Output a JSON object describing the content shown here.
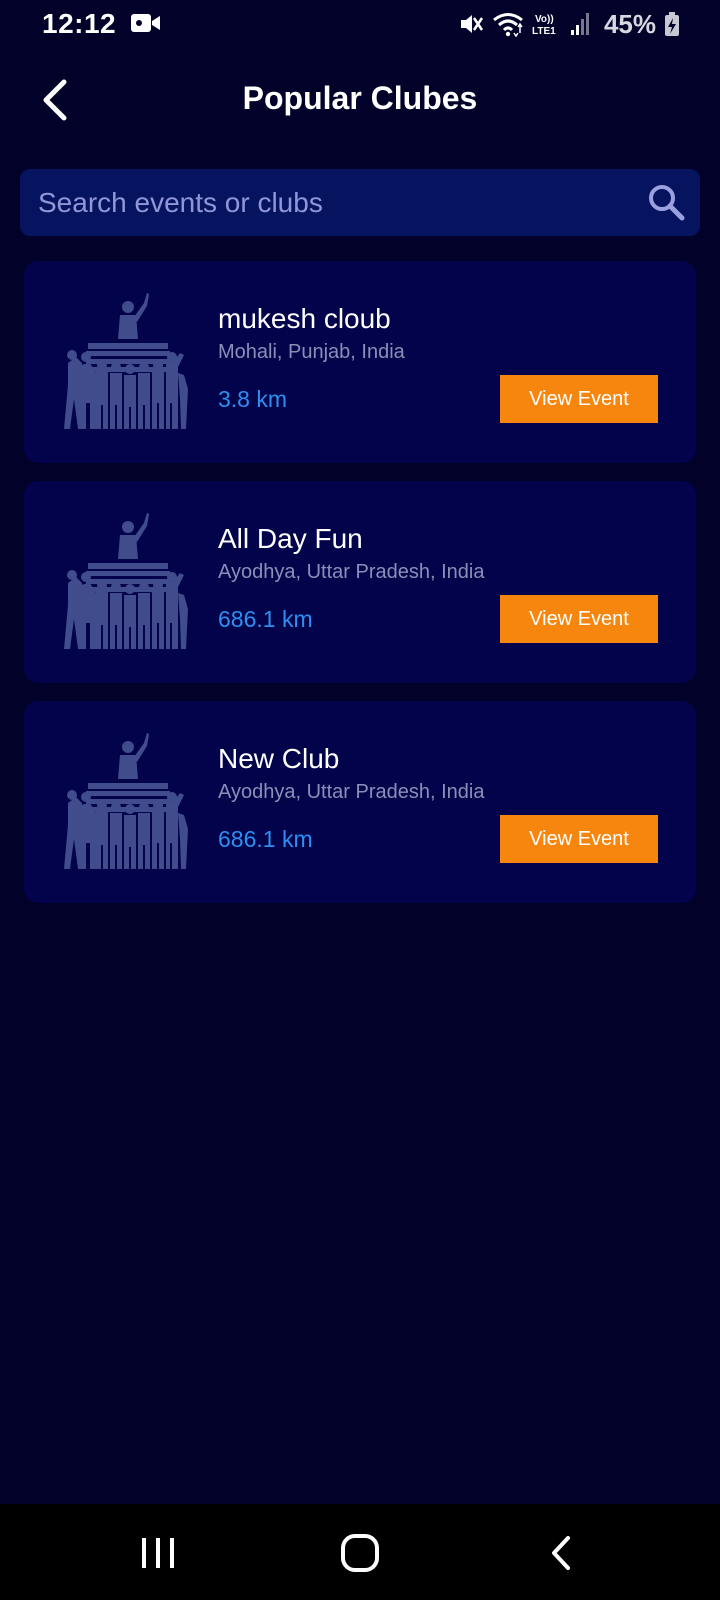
{
  "status_bar": {
    "time": "12:12",
    "battery": "45%",
    "network": "Vo)) LTE1"
  },
  "header": {
    "title": "Popular Clubes",
    "back_icon": "chevron-left-icon"
  },
  "search": {
    "placeholder": "Search events or clubs",
    "icon": "search-icon"
  },
  "clubs": [
    {
      "name": "mukesh cloub",
      "location": "Mohali, Punjab, India",
      "distance": "3.8 km",
      "button": "View Event"
    },
    {
      "name": "All Day Fun",
      "location": "Ayodhya, Uttar Pradesh, India",
      "distance": "686.1 km",
      "button": "View Event"
    },
    {
      "name": "New Club",
      "location": "Ayodhya, Uttar Pradesh, India",
      "distance": "686.1 km",
      "button": "View Event"
    }
  ],
  "nav": {
    "recent_icon": "recent-apps-icon",
    "home_icon": "home-icon",
    "back_icon": "back-icon"
  },
  "colors": {
    "background": "#01012a",
    "card": "#03034c",
    "search_bg": "#061460",
    "accent": "#f7860f",
    "distance": "#2e8ff0"
  }
}
